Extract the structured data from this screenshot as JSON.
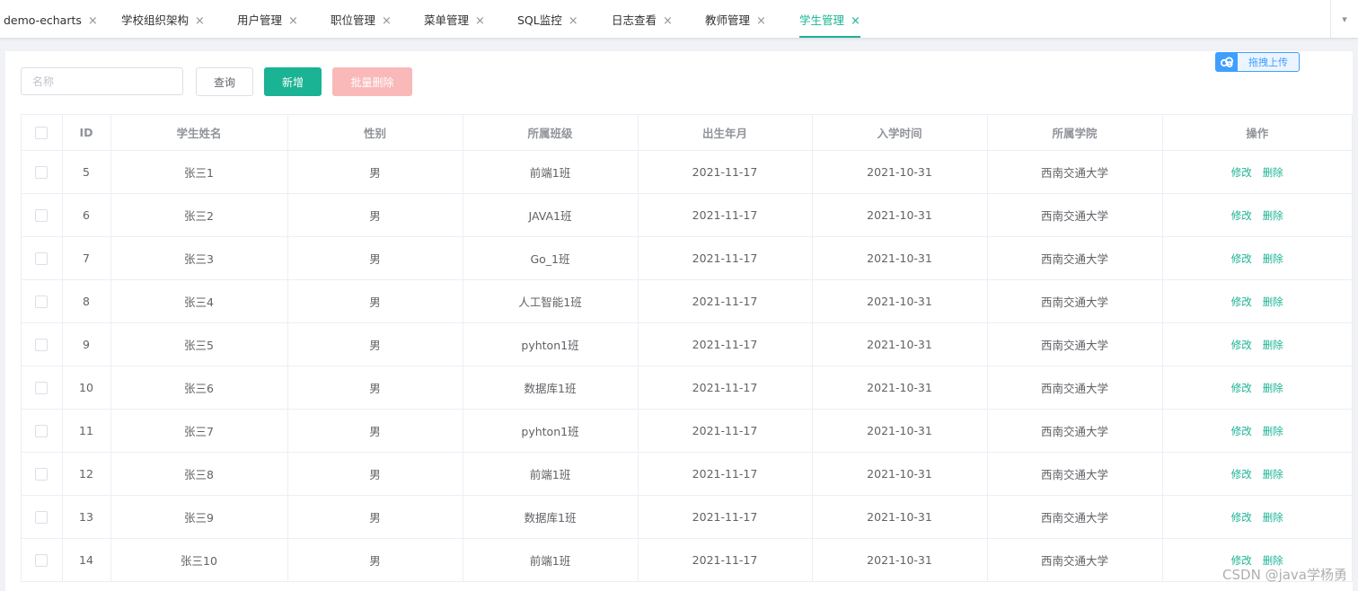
{
  "tabs": [
    {
      "label": "demo-echarts",
      "active": false
    },
    {
      "label": "学校组织架构",
      "active": false
    },
    {
      "label": "用户管理",
      "active": false
    },
    {
      "label": "职位管理",
      "active": false
    },
    {
      "label": "菜单管理",
      "active": false
    },
    {
      "label": "SQL监控",
      "active": false
    },
    {
      "label": "日志查看",
      "active": false
    },
    {
      "label": "教师管理",
      "active": false
    },
    {
      "label": "学生管理",
      "active": true
    }
  ],
  "tab_close_glyph": "×",
  "toolbar": {
    "search_placeholder": "名称",
    "search_value": "",
    "query_label": "查询",
    "add_label": "新增",
    "batch_delete_label": "批量删除",
    "upload_label": "拖拽上传"
  },
  "colors": {
    "accent": "#1ab394",
    "danger_disabled": "#f9b9b9",
    "upload_blue": "#409eff"
  },
  "table": {
    "headers": [
      "ID",
      "学生姓名",
      "性别",
      "所属班级",
      "出生年月",
      "入学时间",
      "所属学院",
      "操作"
    ],
    "rows": [
      {
        "id": "5",
        "name": "张三1",
        "gender": "男",
        "class": "前端1班",
        "birth": "2021-11-17",
        "enroll": "2021-10-31",
        "college": "西南交通大学"
      },
      {
        "id": "6",
        "name": "张三2",
        "gender": "男",
        "class": "JAVA1班",
        "birth": "2021-11-17",
        "enroll": "2021-10-31",
        "college": "西南交通大学"
      },
      {
        "id": "7",
        "name": "张三3",
        "gender": "男",
        "class": "Go_1班",
        "birth": "2021-11-17",
        "enroll": "2021-10-31",
        "college": "西南交通大学"
      },
      {
        "id": "8",
        "name": "张三4",
        "gender": "男",
        "class": "人工智能1班",
        "birth": "2021-11-17",
        "enroll": "2021-10-31",
        "college": "西南交通大学"
      },
      {
        "id": "9",
        "name": "张三5",
        "gender": "男",
        "class": "pyhton1班",
        "birth": "2021-11-17",
        "enroll": "2021-10-31",
        "college": "西南交通大学"
      },
      {
        "id": "10",
        "name": "张三6",
        "gender": "男",
        "class": "数据库1班",
        "birth": "2021-11-17",
        "enroll": "2021-10-31",
        "college": "西南交通大学"
      },
      {
        "id": "11",
        "name": "张三7",
        "gender": "男",
        "class": "pyhton1班",
        "birth": "2021-11-17",
        "enroll": "2021-10-31",
        "college": "西南交通大学"
      },
      {
        "id": "12",
        "name": "张三8",
        "gender": "男",
        "class": "前端1班",
        "birth": "2021-11-17",
        "enroll": "2021-10-31",
        "college": "西南交通大学"
      },
      {
        "id": "13",
        "name": "张三9",
        "gender": "男",
        "class": "数据库1班",
        "birth": "2021-11-17",
        "enroll": "2021-10-31",
        "college": "西南交通大学"
      },
      {
        "id": "14",
        "name": "张三10",
        "gender": "男",
        "class": "前端1班",
        "birth": "2021-11-17",
        "enroll": "2021-10-31",
        "college": "西南交通大学"
      }
    ],
    "edit_label": "修改",
    "delete_label": "删除"
  },
  "watermark": "CSDN @java学杨勇"
}
